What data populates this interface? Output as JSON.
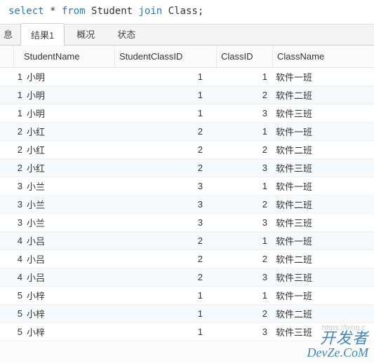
{
  "sql": {
    "kw1": "select",
    "star": "*",
    "kw2": "from",
    "tbl1": "Student",
    "kw3": "join",
    "tbl2": "Class",
    "semi": ";"
  },
  "tabs": {
    "msg": "息",
    "result1": "结果1",
    "overview": "概况",
    "status": "状态"
  },
  "columns": {
    "studentName": "StudentName",
    "studentClassId": "StudentClassID",
    "classId": "ClassID",
    "className": "ClassName"
  },
  "rows": [
    {
      "sid": 1,
      "sname": "小明",
      "scid": 1,
      "cid": 1,
      "cname": "软件一班"
    },
    {
      "sid": 1,
      "sname": "小明",
      "scid": 1,
      "cid": 2,
      "cname": "软件二班"
    },
    {
      "sid": 1,
      "sname": "小明",
      "scid": 1,
      "cid": 3,
      "cname": "软件三班"
    },
    {
      "sid": 2,
      "sname": "小红",
      "scid": 2,
      "cid": 1,
      "cname": "软件一班"
    },
    {
      "sid": 2,
      "sname": "小红",
      "scid": 2,
      "cid": 2,
      "cname": "软件二班"
    },
    {
      "sid": 2,
      "sname": "小红",
      "scid": 2,
      "cid": 3,
      "cname": "软件三班"
    },
    {
      "sid": 3,
      "sname": "小兰",
      "scid": 3,
      "cid": 1,
      "cname": "软件一班"
    },
    {
      "sid": 3,
      "sname": "小兰",
      "scid": 3,
      "cid": 2,
      "cname": "软件二班"
    },
    {
      "sid": 3,
      "sname": "小兰",
      "scid": 3,
      "cid": 3,
      "cname": "软件三班"
    },
    {
      "sid": 4,
      "sname": "小吕",
      "scid": 2,
      "cid": 1,
      "cname": "软件一班"
    },
    {
      "sid": 4,
      "sname": "小吕",
      "scid": 2,
      "cid": 2,
      "cname": "软件二班"
    },
    {
      "sid": 4,
      "sname": "小吕",
      "scid": 2,
      "cid": 3,
      "cname": "软件三班"
    },
    {
      "sid": 5,
      "sname": "小梓",
      "scid": 1,
      "cid": 1,
      "cname": "软件一班"
    },
    {
      "sid": 5,
      "sname": "小梓",
      "scid": 1,
      "cid": 2,
      "cname": "软件二班"
    },
    {
      "sid": 5,
      "sname": "小梓",
      "scid": 1,
      "cid": 3,
      "cname": "软件三班"
    }
  ],
  "watermark": {
    "line1": "开发者",
    "line2": "DevZe.CoM",
    "url": "https://blog.c"
  }
}
